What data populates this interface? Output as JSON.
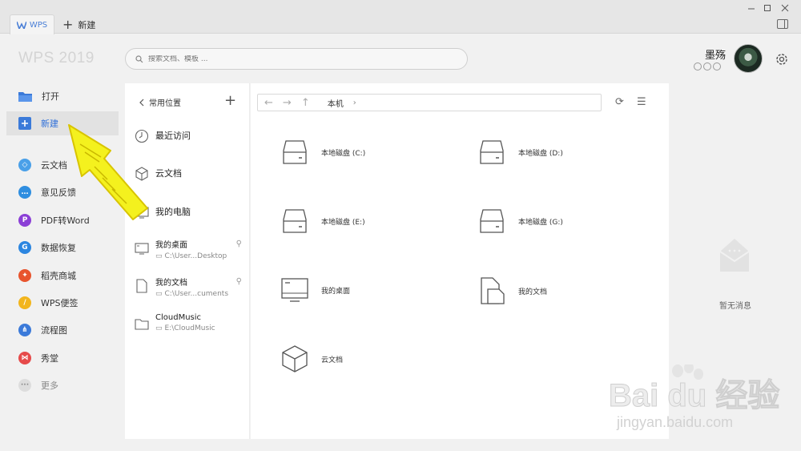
{
  "titlebar": {
    "tab_wps": "WPS",
    "tab_new": "新建"
  },
  "header": {
    "logo": "WPS 2019",
    "search_placeholder": "搜索文档、模板 ...",
    "user_name": "墨殇"
  },
  "nav": [
    {
      "label": "打开",
      "icon": "folder-icon"
    },
    {
      "label": "新建",
      "icon": "plus-icon",
      "active": true
    },
    {
      "label": "云文档",
      "icon": "cube-icon"
    },
    {
      "label": "意见反馈",
      "icon": "chat-icon"
    },
    {
      "label": "PDF转Word",
      "icon": "pdf-icon"
    },
    {
      "label": "数据恢复",
      "icon": "recover-icon"
    },
    {
      "label": "稻壳商城",
      "icon": "store-icon"
    },
    {
      "label": "WPS便签",
      "icon": "note-icon"
    },
    {
      "label": "流程图",
      "icon": "flowchart-icon"
    },
    {
      "label": "秀堂",
      "icon": "xiutang-icon"
    },
    {
      "label": "更多",
      "icon": "more-icon"
    }
  ],
  "locations": {
    "header": "常用位置",
    "items": [
      {
        "label": "最近访问",
        "icon": "clock-icon"
      },
      {
        "label": "云文档",
        "icon": "cube-icon"
      },
      {
        "label": "我的电脑",
        "icon": "computer-icon"
      },
      {
        "label": "我的桌面",
        "path": "C:\\User...Desktop",
        "icon": "monitor-icon"
      },
      {
        "label": "我的文档",
        "path": "C:\\User...cuments",
        "icon": "document-icon"
      },
      {
        "label": "CloudMusic",
        "path": "E:\\CloudMusic",
        "icon": "folder-icon"
      }
    ]
  },
  "explorer": {
    "crumb": "本机",
    "items": [
      {
        "label": "本地磁盘 (C:)",
        "icon": "drive-icon"
      },
      {
        "label": "本地磁盘 (D:)",
        "icon": "drive-icon"
      },
      {
        "label": "本地磁盘 (E:)",
        "icon": "drive-icon"
      },
      {
        "label": "本地磁盘 (G:)",
        "icon": "drive-icon"
      },
      {
        "label": "我的桌面",
        "icon": "monitor-icon"
      },
      {
        "label": "我的文档",
        "icon": "document-icon"
      },
      {
        "label": "云文档",
        "icon": "cube-icon"
      }
    ]
  },
  "messages": {
    "empty": "暂无消息"
  },
  "watermark": {
    "brand": "Bai du 经验",
    "url": "jingyan.baidu.com"
  },
  "colors": {
    "accent": "#2e6fd9",
    "arrow": "#f4f11e"
  }
}
